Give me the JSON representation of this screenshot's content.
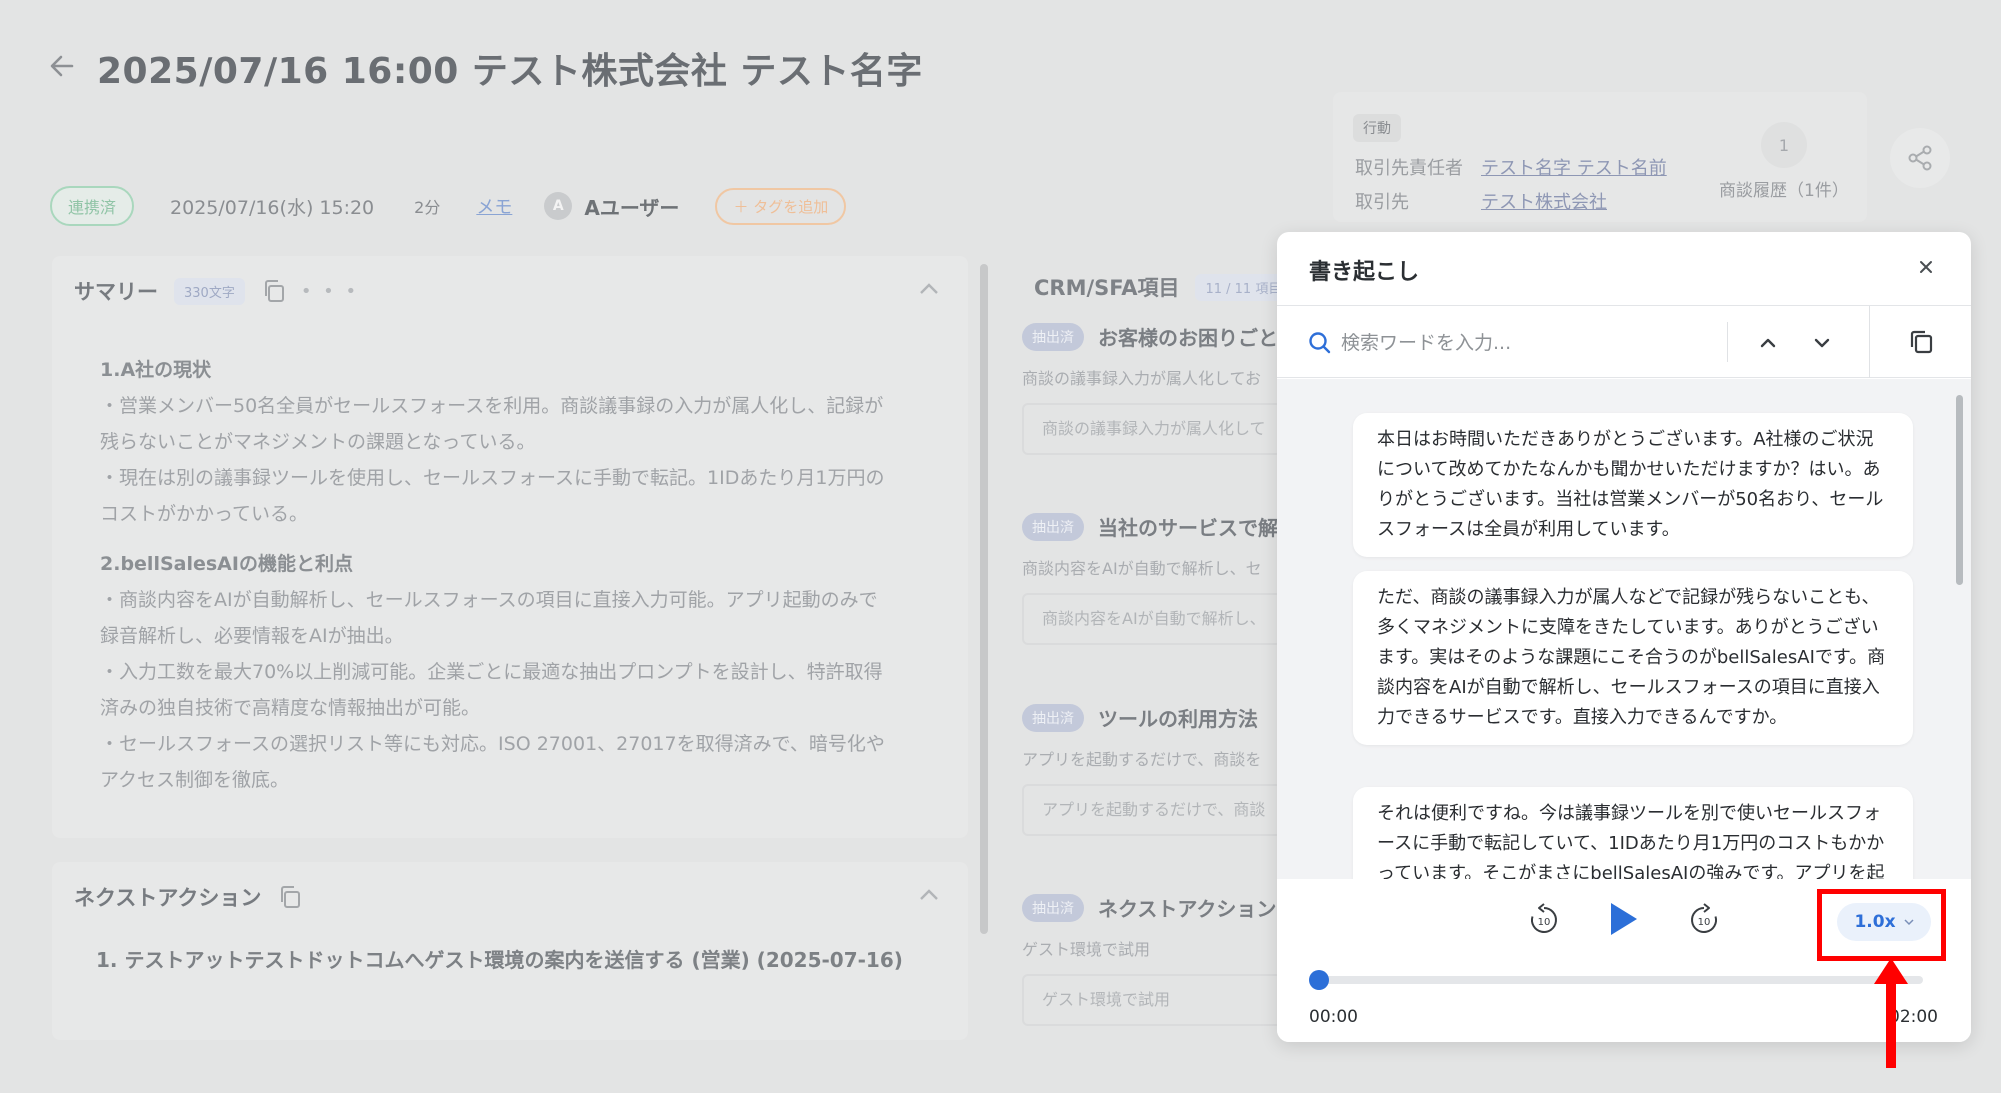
{
  "header": {
    "title": "2025/07/16 16:00 テスト株式会社 テスト名字"
  },
  "meta": {
    "status_badge": "連携済",
    "datetime": "2025/07/16(水) 15:20",
    "duration": "2分",
    "memo_link": "メモ",
    "avatar_letter": "A",
    "user_name": "Aユーザー",
    "add_tag": "＋ タグを追加"
  },
  "info_card": {
    "chip": "行動",
    "contact_label": "取引先責任者",
    "contact_value": "テスト名字 テスト名前",
    "account_label": "取引先",
    "account_value": "テスト株式会社",
    "history_count": "1",
    "history_label": "商談履歴（1件）"
  },
  "summary": {
    "title": "サマリー",
    "char_count": "330文字",
    "dots": "• • •",
    "section1_heading": "1.A社の現状",
    "section1_line1": "・営業メンバー50名全員がセールスフォースを利用。商談議事録の入力が属人化し、記録が",
    "section1_line2": "残らないことがマネジメントの課題となっている。",
    "section1_line3": "・現在は別の議事録ツールを使用し、セールスフォースに手動で転記。1IDあたり月1万円の",
    "section1_line4": "コストがかかっている。",
    "section2_heading": "2.bellSalesAIの機能と利点",
    "section2_line1": "・商談内容をAIが自動解析し、セールスフォースの項目に直接入力可能。アプリ起動のみで",
    "section2_line2": "録音解析し、必要情報をAIが抽出。",
    "section2_line3": "・入力工数を最大70%以上削減可能。企業ごとに最適な抽出プロンプトを設計し、特許取得",
    "section2_line4": "済みの独自技術で高精度な情報抽出が可能。",
    "section2_line5": "・セールスフォースの選択リスト等にも対応。ISO 27001、27017を取得済みで、暗号化や",
    "section2_line6": "アクセス制御を徹底。"
  },
  "next_action": {
    "title": "ネクストアクション",
    "item1": "1. テストアットテストドットコムへゲスト環境の案内を送信する (営業) (2025-07-16)"
  },
  "crm": {
    "title": "CRM/SFA項目",
    "count": "11 / 11 項目",
    "chip": "抽出済",
    "items": [
      {
        "name": "お客様のお困りごと",
        "desc": "商談の議事録入力が属人化してお",
        "value": "商談の議事録入力が属人化して"
      },
      {
        "name": "当社のサービスで解",
        "desc": "商談内容をAIが自動で解析し、セ",
        "value": "商談内容をAIが自動で解析し、"
      },
      {
        "name": "ツールの利用方法",
        "desc": "アプリを起動するだけで、商談を",
        "value": "アプリを起動するだけで、商談"
      },
      {
        "name": "ネクストアクション",
        "desc": "ゲスト環境で試用",
        "value": "ゲスト環境で試用"
      }
    ]
  },
  "transcript_dialog": {
    "title": "書き起こし",
    "search_placeholder": "検索ワードを入力...",
    "messages": [
      "本日はお時間いただきありがとうございます。A社様のご状況について改めてかたなんかも聞かせいただけますか？はい。ありがとうございます。当社は営業メンバーが50名おり、セールスフォースは全員が利用しています。",
      "ただ、商談の議事録入力が属人などで記録が残らないことも、多くマネジメントに支障をきたしています。ありがとうございます。実はそのような課題にこそ合うのがbellSalesAIです。商談内容をAIが自動で解析し、セールスフォースの項目に直接入力できるサービスです。直接入力できるんですか。",
      "それは便利ですね。今は議事録ツールを別で使いセールスフォースに手動で転記していて、1IDあたり月1万円のコストもかかっています。そこがまさにbellSalesAIの強みです。アプリを起動するだけで"
    ],
    "player": {
      "speed": "1.0x",
      "time_current": "00:00",
      "time_total": "02:00",
      "progress": 0
    }
  },
  "colors": {
    "accent": "#2c6fd8",
    "highlight_box": "#ff0000"
  }
}
